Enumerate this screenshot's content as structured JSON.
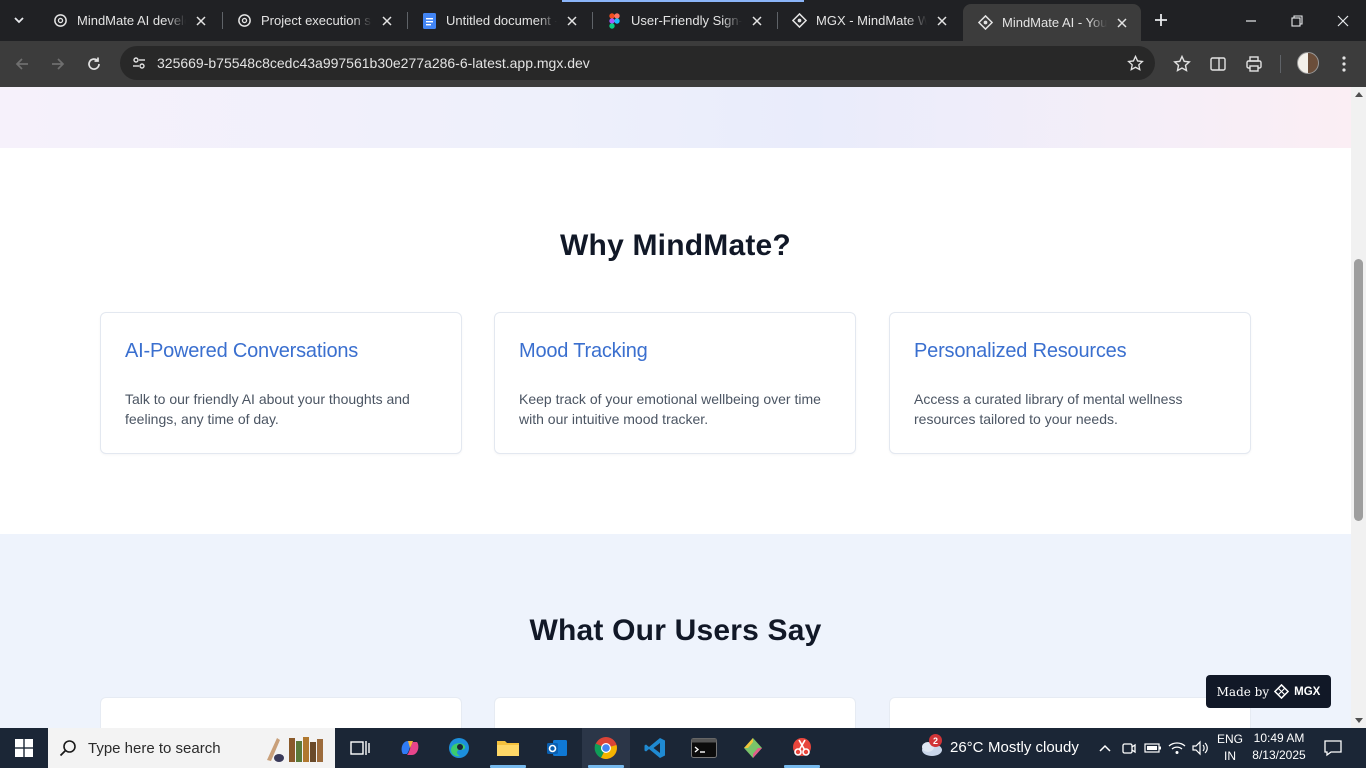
{
  "browser": {
    "tabs": [
      {
        "title": "MindMate AI develop",
        "favicon": "openai-icon"
      },
      {
        "title": "Project execution sup",
        "favicon": "openai-icon"
      },
      {
        "title": "Untitled document - G",
        "favicon": "google-docs-icon"
      },
      {
        "title": "User-Friendly Sign-Up",
        "favicon": "figma-icon"
      },
      {
        "title": "MGX - MindMate Win",
        "favicon": "mgx-icon"
      },
      {
        "title": "MindMate AI - Your M",
        "favicon": "mgx-icon",
        "active": true
      }
    ],
    "url": "325669-b75548c8cedc43a997561b30e277a286-6-latest.app.mgx.dev"
  },
  "page": {
    "why_title": "Why MindMate?",
    "features": [
      {
        "title": "AI-Powered Conversations",
        "description": "Talk to our friendly AI about your thoughts and feelings, any time of day."
      },
      {
        "title": "Mood Tracking",
        "description": "Keep track of your emotional wellbeing over time with our intuitive mood tracker."
      },
      {
        "title": "Personalized Resources",
        "description": "Access a curated library of mental wellness resources tailored to your needs."
      }
    ],
    "testimonials_title": "What Our Users Say",
    "made_by": {
      "label": "Made by",
      "brand": "MGX"
    }
  },
  "colors": {
    "accent": "#3a6fcf",
    "heading": "#111827",
    "testimonial_bg": "#eef3fc",
    "chrome_frame": "#202124",
    "chrome_toolbar": "#3c3c3c",
    "taskbar": "#1b2636"
  },
  "taskbar": {
    "search_placeholder": "Type here to search",
    "weather": {
      "temp": "26°C",
      "condition": "Mostly cloudy",
      "badge": "2"
    },
    "language": {
      "line1": "ENG",
      "line2": "IN"
    },
    "time": "10:49 AM",
    "date": "8/13/2025",
    "apps": [
      "task-view-icon",
      "copilot-icon",
      "edge-icon",
      "file-explorer-icon",
      "outlook-icon",
      "chrome-icon",
      "vscode-icon",
      "terminal-icon",
      "git-icon",
      "snipping-tool-icon"
    ]
  }
}
